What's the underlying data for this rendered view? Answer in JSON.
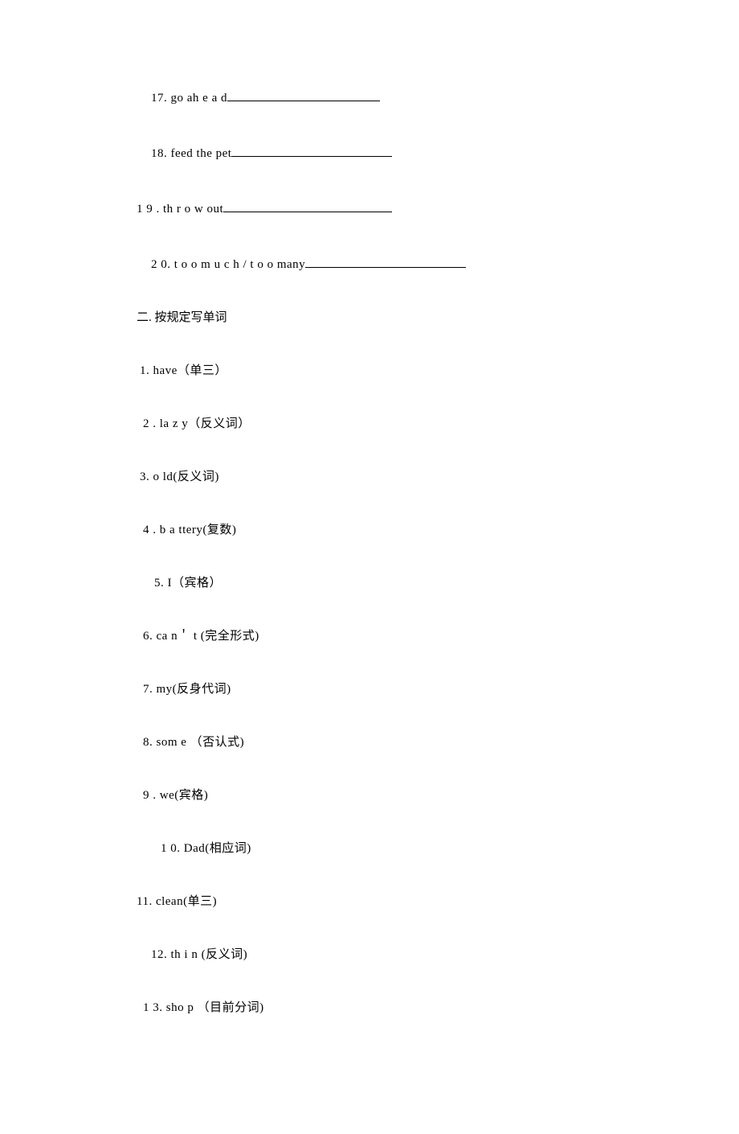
{
  "lines": [
    {
      "cls": "indent-a",
      "text": "17. go  ah e a d",
      "blank": 190
    },
    {
      "cls": "indent-a",
      "text": "18. feed the pet",
      "blank": 200
    },
    {
      "cls": "indent-0",
      "text": "1 9 .  th r o w  out",
      "blank": 210
    },
    {
      "cls": "indent-a",
      "text": " 2 0.  t o o m u c h  /  t o o  many",
      "blank": 200
    }
  ],
  "section2_title": "二. 按规定写单词",
  "items2": [
    {
      "cls": "indent-c",
      "text": " 1.   have（单三）"
    },
    {
      "cls": "indent-b",
      "text": " 2 .   la z y（反义词）"
    },
    {
      "cls": "indent-c",
      "text": " 3.  o ld(反义词)"
    },
    {
      "cls": "indent-b",
      "text": " 4 .    b a ttery(复数)"
    },
    {
      "cls": "indent-d",
      "text": "5.   I（宾格）"
    },
    {
      "cls": "indent-b",
      "text": "6. ca n＇ t (完全形式)"
    },
    {
      "cls": "indent-b",
      "text": "7.  my(反身代词)"
    },
    {
      "cls": "indent-b",
      "text": "8.  som e （否认式)"
    },
    {
      "cls": "indent-b",
      "text": " 9 . we(宾格)"
    },
    {
      "cls": "indent-e",
      "text": "1 0.  Dad(相应词)"
    },
    {
      "cls": "indent-0",
      "text": "11. clean(单三)"
    },
    {
      "cls": "indent-a",
      "text": "12.  th i n (反义词)"
    },
    {
      "cls": "indent-b",
      "text": "1 3.   sho p （目前分词)"
    }
  ]
}
